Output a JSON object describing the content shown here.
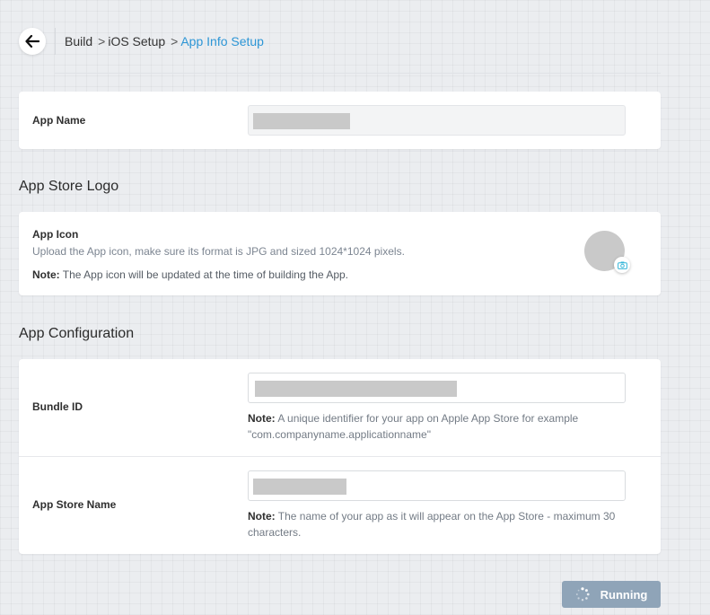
{
  "breadcrumb": {
    "items": [
      {
        "label": "Build"
      },
      {
        "label": "iOS Setup"
      },
      {
        "label": "App Info Setup"
      }
    ],
    "separator": ">"
  },
  "app_name": {
    "label": "App Name"
  },
  "logo_section": {
    "title": "App Store Logo",
    "icon_label": "App Icon",
    "description": "Upload the App icon, make sure its format is JPG and sized 1024*1024 pixels.",
    "note_label": "Note:",
    "note_text": "The App icon will be updated at the time of building the App."
  },
  "config_section": {
    "title": "App Configuration",
    "bundle": {
      "label": "Bundle ID",
      "note_label": "Note:",
      "note_text": "A unique identifier for your app on Apple App Store for example \"com.companyname.applicationname\""
    },
    "store_name": {
      "label": "App Store Name",
      "note_label": "Note:",
      "note_text": "The name of your app as it will appear on the App Store - maximum 30 characters."
    }
  },
  "actions": {
    "run_label": "Running"
  },
  "icons": {
    "back": "arrow-left-icon",
    "camera": "camera-icon",
    "spinner": "spinner-icon"
  },
  "colors": {
    "link": "#2d96d6",
    "button": "#8fa4b8",
    "masked": "#c9c9c9"
  }
}
